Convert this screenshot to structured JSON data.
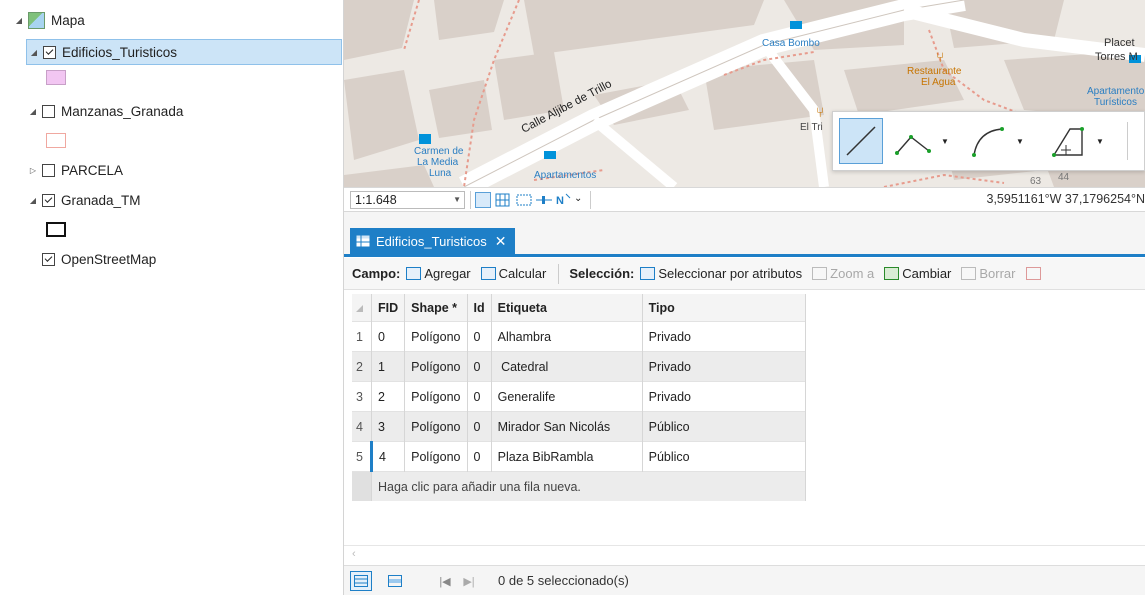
{
  "toc": {
    "map_name": "Mapa",
    "layers": [
      {
        "name": "Edificios_Turisticos",
        "checked": true,
        "swatch_fill": "#f2c6f2",
        "swatch_stroke": "#c8a0c8"
      },
      {
        "name": "Manzanas_Granada",
        "checked": false,
        "swatch_fill": "#fff",
        "swatch_stroke": "#f0a8a0"
      },
      {
        "name": "PARCELA",
        "checked": false
      },
      {
        "name": "Granada_TM",
        "checked": true,
        "swatch_fill": "#fff",
        "swatch_stroke": "#111"
      },
      {
        "name": "OpenStreetMap",
        "checked": true
      }
    ]
  },
  "map": {
    "labels": {
      "casa_bombo": "Casa Bombo",
      "placeta": "Placet",
      "torres": "Torres M",
      "restaurante": "Restaurante",
      "el_agua": "El Agua",
      "apartamentos_right_1": "Apartamento",
      "apartamentos_right_2": "Turísticos",
      "calle": "Calle Aljibe de Trillo",
      "carmen_1": "Carmen de",
      "carmen_2": "La Media",
      "carmen_3": "Luna",
      "apartamentos": "Apartamentos",
      "el_tri": "El Tri",
      "num_63": "63",
      "num_44": "44"
    },
    "scale": "1:1.648",
    "coordinates": "3,5951161°W 37,1796254°N"
  },
  "attribute_table": {
    "tab_title": "Edificios_Turisticos",
    "toolbar": {
      "campo_label": "Campo:",
      "agregar": "Agregar",
      "calcular": "Calcular",
      "seleccion_label": "Selección:",
      "seleccionar_por_atributos": "Seleccionar por atributos",
      "zoom_a": "Zoom a",
      "cambiar": "Cambiar",
      "borrar": "Borrar"
    },
    "columns": [
      "FID",
      "Shape *",
      "Id",
      "Etiqueta",
      "Tipo"
    ],
    "rows": [
      {
        "n": "1",
        "fid": "0",
        "shape": "Polígono",
        "id": "0",
        "etiqueta": "Alhambra",
        "tipo": "Privado"
      },
      {
        "n": "2",
        "fid": "1",
        "shape": "Polígono",
        "id": "0",
        "etiqueta": " Catedral",
        "tipo": "Privado"
      },
      {
        "n": "3",
        "fid": "2",
        "shape": "Polígono",
        "id": "0",
        "etiqueta": "Generalife",
        "tipo": "Privado"
      },
      {
        "n": "4",
        "fid": "3",
        "shape": "Polígono",
        "id": "0",
        "etiqueta": "Mirador San Nicolás",
        "tipo": "Público"
      },
      {
        "n": "5",
        "fid": "4",
        "shape": "Polígono",
        "id": "0",
        "etiqueta": "Plaza BibRambla",
        "tipo": "Público"
      }
    ],
    "add_row_hint": "Haga clic para añadir una fila nueva.",
    "selection_count": "0 de 5 seleccionado(s)"
  },
  "colors": {
    "accent": "#1e7fc7",
    "selection_bg": "#cce4f7",
    "map_bg": "#ede9e4",
    "building": "#d9d0c9",
    "road": "#ffffff"
  }
}
